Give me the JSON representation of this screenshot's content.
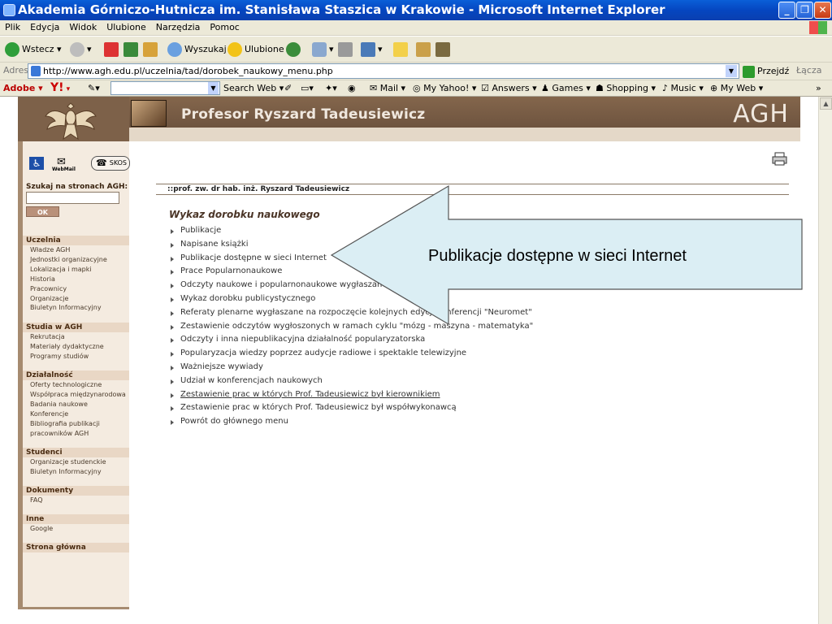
{
  "window": {
    "title": "Akademia Górniczo-Hutnicza im. Stanisława Staszica w Krakowie - Microsoft Internet Explorer",
    "min_icon": "minimize-icon",
    "max_icon": "maximize-icon",
    "close_icon": "close-icon"
  },
  "menu": [
    "Plik",
    "Edycja",
    "Widok",
    "Ulubione",
    "Narzędzia",
    "Pomoc"
  ],
  "toolbar": {
    "back": "Wstecz",
    "search": "Wyszukaj",
    "favorites": "Ulubione"
  },
  "address": {
    "label": "Adres",
    "url": "http://www.agh.edu.pl/uczelnia/tad/dorobek_naukowy_menu.php",
    "go": "Przejdź",
    "links": "Łącza"
  },
  "yahoo_toolbar": {
    "adobe": "Adobe",
    "yahoo": "Y!",
    "search_web": "Search Web",
    "mail": "Mail",
    "my_yahoo": "My Yahoo!",
    "answers": "Answers",
    "games": "Games",
    "shopping": "Shopping",
    "music": "Music",
    "my_web": "My Web"
  },
  "page": {
    "professor_name": "Profesor  Ryszard Tadeusiewicz",
    "agh": "AGH",
    "webmail": "WebMail",
    "skos": "SKOS",
    "search_label": "Szukaj na stronach AGH:",
    "ok": "OK",
    "sidebar": [
      {
        "header": "Uczelnia",
        "items": [
          "Władze AGH",
          "Jednostki organizacyjne",
          "Lokalizacja i mapki",
          "Historia",
          "Pracownicy",
          "Organizacje",
          "Biuletyn Informacyjny"
        ]
      },
      {
        "header": "Studia w AGH",
        "items": [
          "Rekrutacja",
          "Materiały dydaktyczne",
          "Programy studiów"
        ]
      },
      {
        "header": "Działalność",
        "items": [
          "Oferty technologiczne",
          "Współpraca międzynarodowa",
          "Badania naukowe",
          "Konferencje",
          "Bibliografia publikacji",
          "pracowników AGH"
        ]
      },
      {
        "header": "Studenci",
        "items": [
          "Organizacje studenckie",
          "Biuletyn Informacyjny"
        ]
      },
      {
        "header": "Dokumenty",
        "items": [
          "FAQ"
        ]
      },
      {
        "header": "Inne",
        "items": [
          "Google"
        ]
      },
      {
        "header": "Strona główna",
        "items": []
      }
    ],
    "breadcrumb": "::prof. zw. dr hab. inż. Ryszard Tadeusiewicz",
    "heading": "Wykaz dorobku naukowego",
    "items": [
      "Publikacje",
      "Napisane książki",
      "Publikacje dostępne w sieci Internet",
      "Prace Popularnonaukowe",
      "Odczyty naukowe i popularnonaukowe wygłaszane",
      "Wykaz dorobku publicystycznego",
      "Referaty plenarne wygłaszane na rozpoczęcie kolejnych edycji konferencji \"Neuromet\"",
      "Zestawienie odczytów wygłoszonych w ramach cyklu \"mózg - maszyna - matematyka\"",
      "Odczyty i inna niepublikacyjna działalność popularyzatorska",
      "Popularyzacja wiedzy poprzez audycje radiowe i spektakle telewizyjne",
      "Ważniejsze wywiady",
      "Udział w konferencjach naukowych",
      "Zestawienie prac w których Prof. Tadeusiewicz był kierownikiem",
      "Zestawienie prac w których Prof. Tadeusiewicz był współwykonawcą",
      "Powrót do głównego menu"
    ],
    "callout": "Publikacje dostępne w sieci Internet"
  },
  "colors": {
    "accent_brown": "#7d6149",
    "sidebar_bg": "#f4ebe0",
    "callout_fill": "#dbeef4"
  }
}
